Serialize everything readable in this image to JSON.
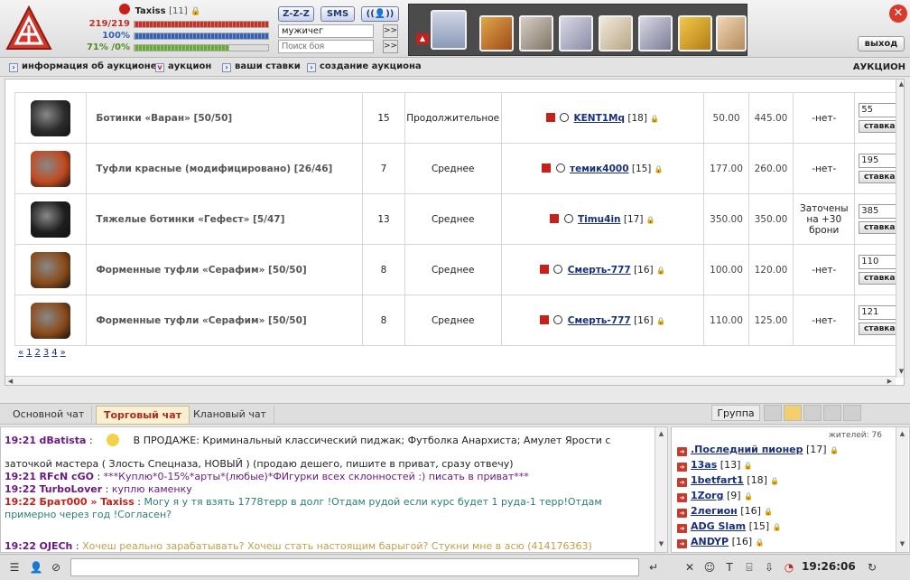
{
  "player": {
    "name": "Taxiss",
    "level_tag": "[11]",
    "hp": "219/219",
    "energy": "100%",
    "xp": "71% /0%",
    "hp_fraction": 1.0,
    "energy_fraction": 1.0,
    "xp_fraction": 0.71
  },
  "topbar": {
    "zzz_label": "Z-Z-Z",
    "sms_label": "SMS",
    "location_value": "мужичег",
    "search_placeholder": "Поиск боя",
    "exit_label": "выход",
    "go_arrow": ">>"
  },
  "nav": {
    "items": [
      "информация об аукционе",
      "аукцион",
      "ваши ставки",
      "создание аукциона"
    ],
    "heading": "АУКЦИОН"
  },
  "lots": [
    {
      "name": "Ботинки «Варан» [50/50]",
      "qty": "15",
      "duration": "Продолжительное",
      "seller": "KENT1Mq",
      "seller_level": "[18]",
      "price": "50.00",
      "buyout": "445.00",
      "condition": "-нет-",
      "bid": "55",
      "item_color": "#2b2b2b"
    },
    {
      "name": "Туфли красные (модифицировано) [26/46]",
      "qty": "7",
      "duration": "Среднее",
      "seller": "темик4000",
      "seller_level": "[15]",
      "price": "177.00",
      "buyout": "260.00",
      "condition": "-нет-",
      "bid": "195",
      "item_color": "#c2491f"
    },
    {
      "name": "Тяжелые ботинки «Гефест» [5/47]",
      "qty": "13",
      "duration": "Среднее",
      "seller": "Timu4in",
      "seller_level": "[17]",
      "price": "350.00",
      "buyout": "350.00",
      "condition": "Заточены на +30 брони",
      "bid": "385",
      "item_color": "#1e1e1e"
    },
    {
      "name": "Форменные туфли «Серафим» [50/50]",
      "qty": "8",
      "duration": "Среднее",
      "seller": "Смерть-777",
      "seller_level": "[16]",
      "price": "100.00",
      "buyout": "120.00",
      "condition": "-нет-",
      "bid": "110",
      "item_color": "#8a4b1a"
    },
    {
      "name": "Форменные туфли «Серафим» [50/50]",
      "qty": "8",
      "duration": "Среднее",
      "seller": "Смерть-777",
      "seller_level": "[16]",
      "price": "110.00",
      "buyout": "125.00",
      "condition": "-нет-",
      "bid": "121",
      "item_color": "#8a4b1a"
    }
  ],
  "bid_button_label": "ставка",
  "pagination": {
    "prev": "«",
    "pages": [
      "1",
      "2",
      "3",
      "4"
    ],
    "next": "»"
  },
  "chat_tabs": [
    "Основной чат",
    "Торговый чат",
    "Клановый чат"
  ],
  "group_label": "Группа",
  "chat": [
    {
      "time": "19:21",
      "nick": "dBatista",
      "text": "В ПРОДАЖЕ: Криминальный классический пиджак; Футболка Анархиста; Амулет Ярости с"
    },
    {
      "time": "",
      "nick": "",
      "text": "заточкой мастера ( Злость Спецназа, НОВЫЙ ) (продаю дешего, пишите в приват, сразу отвечу)"
    },
    {
      "time": "19:21",
      "nick": "RFcN cGO",
      "text": "***Куплю*0-15%*арты*(любые)*ФИгурки всех склонностей :) писать в приват***"
    },
    {
      "time": "19:22",
      "nick": "TurboLover",
      "text": "куплю каменку"
    },
    {
      "time": "19:22",
      "nick": "Брат000 » Taxiss",
      "text": "Могу я у тя взять 1778терр в долг !Отдам рудой если курс будет 1 руда-1 терр!Отдам"
    },
    {
      "time": "",
      "nick": "",
      "text": "примерно через год !Согласен?"
    },
    {
      "time": "19:22",
      "nick": "OJEСh",
      "text": "Хочеш реально зарабатывать? Хочеш стать настоящим барыгой? Стукни мне в асю (414176363)"
    }
  ],
  "users_count_label": "жителей: 76",
  "users": [
    {
      "name": ".Последний пионер",
      "level": "[17]"
    },
    {
      "name": "13as",
      "level": "[13]"
    },
    {
      "name": "1betfart1",
      "level": "[18]"
    },
    {
      "name": "1Zorg",
      "level": "[9]"
    },
    {
      "name": "2легион",
      "level": "[16]"
    },
    {
      "name": "ADG Slam",
      "level": "[15]"
    },
    {
      "name": "ANDYP",
      "level": "[16]"
    }
  ],
  "clock": "19:26:06",
  "colors": {
    "hp": "#c43129",
    "energy": "#3561b3",
    "xp": "#6ca83a",
    "accent_red": "#c7201b"
  }
}
